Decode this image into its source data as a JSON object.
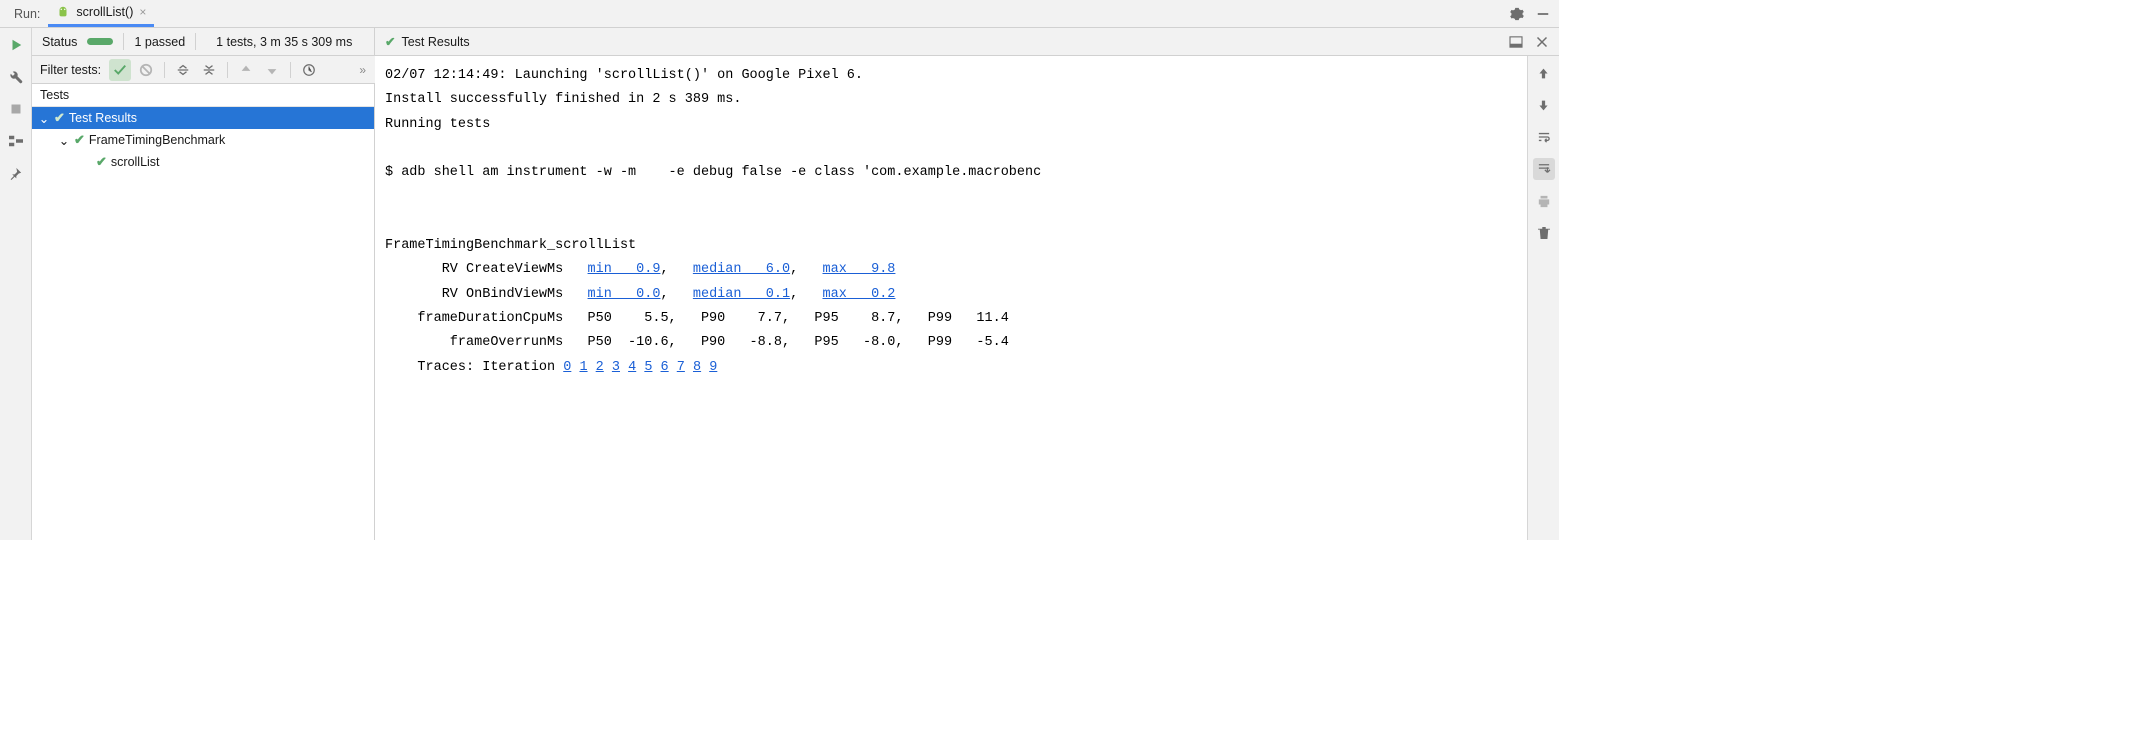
{
  "tabBar": {
    "runLabel": "Run:",
    "tabName": "scrollList()"
  },
  "status": {
    "label": "Status",
    "passed": "1 passed",
    "summary": "1 tests, 3 m 35 s 309 ms",
    "resultsHead": "Test Results"
  },
  "filter": {
    "label": "Filter tests:"
  },
  "tree": {
    "header": "Tests",
    "root": "Test Results",
    "benchmark": "FrameTimingBenchmark",
    "test": "scrollList"
  },
  "console": {
    "line_launch": "02/07 12:14:49: Launching 'scrollList()' on Google Pixel 6.",
    "line_install": "Install successfully finished in 2 s 389 ms.",
    "line_running": "Running tests",
    "line_adb": "$ adb shell am instrument -w -m    -e debug false -e class 'com.example.macrobenc",
    "line_title": "FrameTimingBenchmark_scrollList",
    "metrics": [
      {
        "label": "RV CreateViewMs",
        "linked": true,
        "cells": [
          "min   0.9",
          "median   6.0",
          "max   9.8"
        ],
        "trail": ""
      },
      {
        "label": "RV OnBindViewMs",
        "linked": true,
        "cells": [
          "min   0.0",
          "median   0.1",
          "max   0.2"
        ],
        "trail": ""
      },
      {
        "label": "frameDurationCpuMs",
        "linked": false,
        "cells": [
          "P50    5.5",
          "P90    7.7",
          "P95    8.7",
          "P99   11.4"
        ],
        "trail": ""
      },
      {
        "label": "frameOverrunMs",
        "linked": false,
        "cells": [
          "P50  -10.6",
          "P90   -8.8",
          "P95   -8.0",
          "P99   -5.4"
        ],
        "trail": ""
      }
    ],
    "tracesLabel": "Traces: Iteration",
    "traces": [
      "0",
      "1",
      "2",
      "3",
      "4",
      "5",
      "6",
      "7",
      "8",
      "9"
    ]
  }
}
